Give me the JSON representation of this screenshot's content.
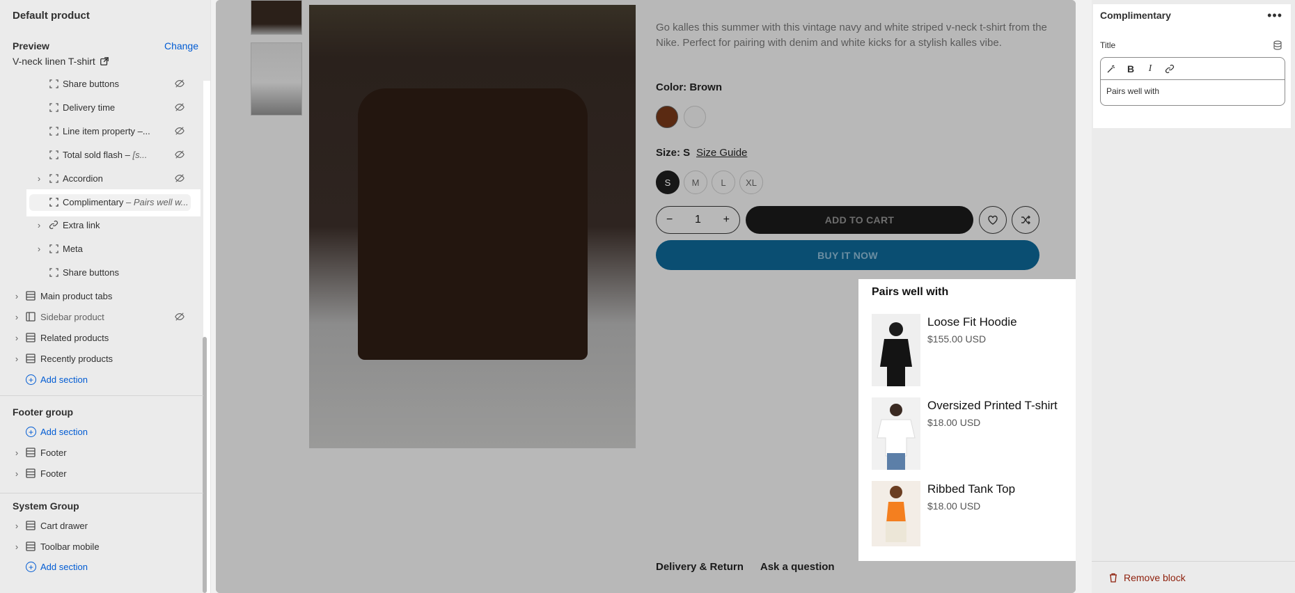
{
  "sidebar": {
    "title": "Default product",
    "preview_label": "Preview",
    "change_label": "Change",
    "product_name": "V-neck linen T-shirt",
    "blocks": [
      {
        "label": "Share buttons",
        "suffix": "",
        "icon": "block-icon",
        "hidden": true
      },
      {
        "label": "Delivery time",
        "suffix": "",
        "icon": "block-icon",
        "hidden": true
      },
      {
        "label": "Line item property –...",
        "suffix": "",
        "icon": "block-icon",
        "hidden": true
      },
      {
        "label": "Total sold flash – ",
        "suffix": "[s...",
        "icon": "block-icon",
        "hidden": true
      },
      {
        "label": "Accordion",
        "suffix": "",
        "icon": "block-icon",
        "hidden": true,
        "expandable": true
      },
      {
        "label": "Complimentary",
        "suffix": " – Pairs well w...",
        "icon": "block-icon",
        "hidden": false,
        "selected": true
      },
      {
        "label": "Extra link",
        "suffix": "",
        "icon": "link-icon",
        "hidden": false,
        "expandable": true
      },
      {
        "label": "Meta",
        "suffix": "",
        "icon": "block-icon",
        "hidden": false,
        "expandable": true
      },
      {
        "label": "Share buttons",
        "suffix": "",
        "icon": "block-icon",
        "hidden": false
      }
    ],
    "sections": [
      {
        "label": "Main product tabs",
        "hidden": false
      },
      {
        "label": "Sidebar product",
        "hidden": true
      },
      {
        "label": "Related products",
        "hidden": false
      },
      {
        "label": "Recently products",
        "hidden": false
      }
    ],
    "add_section_label": "Add section",
    "footer_group": {
      "title": "Footer group",
      "items": [
        "Footer",
        "Footer"
      ]
    },
    "system_group": {
      "title": "System Group",
      "items": [
        "Cart drawer",
        "Toolbar mobile"
      ]
    }
  },
  "product": {
    "description": "Go kalles this summer with this vintage navy and white striped v-neck t-shirt from the Nike. Perfect for pairing with denim and white kicks for a stylish kalles vibe.",
    "color_label": "Color: Brown",
    "swatches": [
      "#7a3a18",
      "#e8e8e8"
    ],
    "size_label": "Size: S",
    "size_guide": "Size Guide",
    "sizes": [
      "S",
      "M",
      "L",
      "XL"
    ],
    "selected_size": "S",
    "quantity": "1",
    "add_to_cart": "ADD TO CART",
    "buy_now": "BUY IT NOW",
    "tabs": [
      "Delivery & Return",
      "Ask a question"
    ]
  },
  "complimentary": {
    "title": "Pairs well with",
    "items": [
      {
        "name": "Loose Fit Hoodie",
        "price": "$155.00 USD"
      },
      {
        "name": "Oversized Printed T-shirt",
        "price": "$18.00 USD"
      },
      {
        "name": "Ribbed Tank Top",
        "price": "$18.00 USD"
      }
    ]
  },
  "settings_panel": {
    "title": "Complimentary",
    "field_label": "Title",
    "field_value": "Pairs well with",
    "remove_label": "Remove block"
  },
  "colors": {
    "accent": "#005bd3",
    "danger": "#8e1f0b",
    "buy_now": "#0a4e72"
  }
}
